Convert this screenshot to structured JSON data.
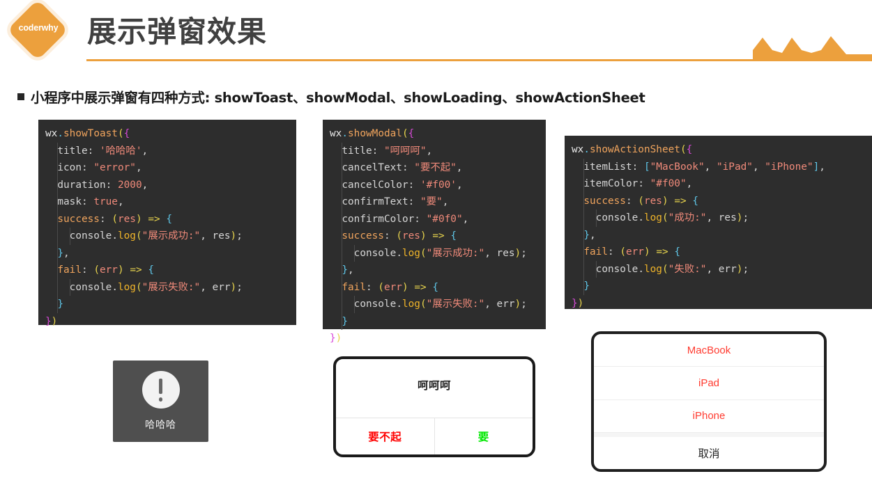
{
  "header": {
    "logo_label": "coderwhy",
    "title": "展示弹窗效果",
    "accent_color": "#eca03d",
    "title_color": "#404040",
    "decoration": "three-mountains"
  },
  "bullet": {
    "marker": "square",
    "text": "小程序中展示弹窗有四种方式: showToast、showModal、showLoading、showActionSheet"
  },
  "code_blocks": [
    {
      "name": "showToast",
      "background": "#2d2d2d",
      "lines": [
        "wx.showToast({",
        "  title: '哈哈哈',",
        "  icon: \"error\",",
        "  duration: 2000,",
        "  mask: true,",
        "  success: (res) => {",
        "    console.log(\"展示成功:\", res);",
        "  },",
        "  fail: (err) => {",
        "    console.log(\"展示失败:\", err);",
        "  }",
        "})"
      ]
    },
    {
      "name": "showModal",
      "background": "#2d2d2d",
      "lines": [
        "wx.showModal({",
        "  title: \"呵呵呵\",",
        "  cancelText: \"要不起\",",
        "  cancelColor: '#f00',",
        "  confirmText: \"要\",",
        "  confirmColor: \"#0f0\",",
        "  success: (res) => {",
        "    console.log(\"展示成功:\", res);",
        "  },",
        "  fail: (err) => {",
        "    console.log(\"展示失败:\", err);",
        "  }",
        "})"
      ]
    },
    {
      "name": "showActionSheet",
      "background": "#2d2d2d",
      "lines": [
        "wx.showActionSheet({",
        "  itemList: [\"MacBook\", \"iPad\", \"iPhone\"],",
        "  itemColor: \"#f00\",",
        "  success: (res) => {",
        "    console.log(\"成功:\", res);",
        "  },",
        "  fail: (err) => {",
        "    console.log(\"失败:\", err);",
        "  }",
        "})"
      ]
    }
  ],
  "previews": {
    "toast": {
      "title": "哈哈哈",
      "icon": "error-exclamation",
      "background": "#4f4f4f",
      "text_color": "#f0f0f0"
    },
    "modal": {
      "title": "呵呵呵",
      "cancel_text": "要不起",
      "cancel_color": "#ff0000",
      "confirm_text": "要",
      "confirm_color": "#00e800"
    },
    "action_sheet": {
      "items": [
        "MacBook",
        "iPad",
        "iPhone"
      ],
      "item_color": "#ff3b30",
      "cancel_text": "取消",
      "cancel_color": "#1f1f1f"
    }
  }
}
